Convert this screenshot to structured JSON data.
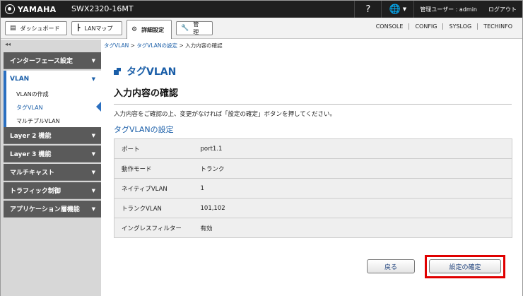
{
  "app": {
    "brand": "YAMAHA",
    "model": "SWX2320-16MT",
    "help_icon": "?",
    "user_label": "管理ユーザー : admin",
    "logout_label": "ログアウト"
  },
  "toolbar": {
    "tabs": [
      {
        "label": "ダッシュボード",
        "icon": "dashboard-icon"
      },
      {
        "label": "LANマップ",
        "icon": "lanmap-icon"
      },
      {
        "label": "詳細設定",
        "icon": "gear-icon"
      },
      {
        "label": "管　理",
        "icon": "wrench-icon"
      }
    ],
    "links": [
      "CONSOLE",
      "CONFIG",
      "SYSLOG",
      "TECHINFO"
    ]
  },
  "sidebar": {
    "collapse": "◂◂",
    "menus": [
      {
        "label": "インターフェース設定"
      },
      {
        "label": "VLAN"
      },
      {
        "label": "Layer 2 機能"
      },
      {
        "label": "Layer 3 機能"
      },
      {
        "label": "マルチキャスト"
      },
      {
        "label": "トラフィック制御"
      },
      {
        "label": "アプリケーション層機能"
      }
    ],
    "vlan_items": [
      "VLANの作成",
      "タグVLAN",
      "マルチプルVLAN"
    ]
  },
  "breadcrumb": {
    "item1": "タグVLAN",
    "item2": "タグVLANの設定",
    "current": "入力内容の確認",
    "sep": ">"
  },
  "main": {
    "page_title": "タグVLAN",
    "section_title": "入力内容の確認",
    "description": "入力内容をご確認の上、変更がなければ「設定の確定」ボタンを押してください。",
    "sub_title": "タグVLANの設定",
    "rows": [
      {
        "key": "ポート",
        "value": "port1.1"
      },
      {
        "key": "動作モード",
        "value": "トランク"
      },
      {
        "key": "ネイティブVLAN",
        "value": "1"
      },
      {
        "key": "トランクVLAN",
        "value": "101,102"
      },
      {
        "key": "イングレスフィルター",
        "value": "有効"
      }
    ],
    "back_button": "戻る",
    "confirm_button": "設定の確定"
  },
  "colors": {
    "accent": "#1a5ea8",
    "highlight": "#e00000",
    "topbar": "#1f1f1f",
    "sidebar_menu": "#5a5a5a"
  }
}
